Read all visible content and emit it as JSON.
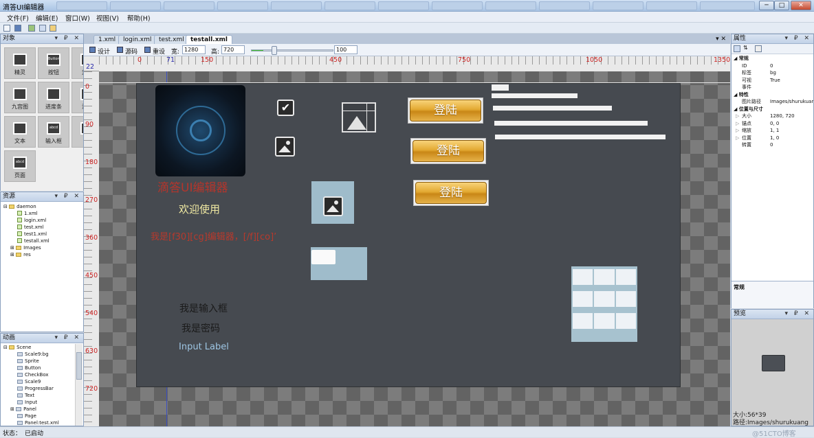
{
  "window": {
    "title": "滴答UI编辑器",
    "min": "─",
    "max": "□",
    "close": "✕"
  },
  "menu": {
    "file": "文件(F)",
    "edit": "编辑(E)",
    "window": "窗口(W)",
    "view": "视图(V)",
    "help": "帮助(H)"
  },
  "objects_panel": {
    "title": "对象",
    "items": [
      {
        "label": "精灵"
      },
      {
        "label": "按钮"
      },
      {
        "label": "复选"
      },
      {
        "label": "九宫图"
      },
      {
        "label": "进度条"
      },
      {
        "label": "滑动"
      },
      {
        "label": "文本"
      },
      {
        "label": "输入框"
      },
      {
        "label": "节"
      },
      {
        "label": "页面"
      }
    ],
    "tile_texts": {
      "button": "Button",
      "input": "abcd"
    }
  },
  "resources_panel": {
    "title": "资源",
    "root": "daemon",
    "files": [
      "1.xml",
      "login.xml",
      "test.xml",
      "test1.xml",
      "testall.xml"
    ],
    "folders": [
      "Images",
      "res"
    ]
  },
  "animation_panel": {
    "title": "动画",
    "root": "Scene",
    "items": [
      "Scale9:bg",
      "Sprite",
      "Button",
      "CheckBox",
      "Scale9",
      "ProgressBar",
      "Text",
      "Input",
      "Panel",
      "Page",
      "Panel:test.xml"
    ]
  },
  "editor": {
    "tabs": [
      "1.xml",
      "login.xml",
      "test.xml",
      "testall.xml"
    ],
    "active_tab": "testall.xml",
    "design_label": "设计",
    "source_label": "源码",
    "reset_label": "重设",
    "width_label": "宽:",
    "width_value": "1280",
    "height_label": "高:",
    "height_value": "720",
    "zoom_value": "100",
    "zoom_level": 0.14,
    "ruler_h": [
      "0",
      "71",
      "150",
      "450",
      "750",
      "1050",
      "1350"
    ],
    "ruler_v": [
      "0",
      "90",
      "180",
      "270",
      "360",
      "450",
      "540",
      "630",
      "720"
    ],
    "ruler_corner": "22"
  },
  "stage": {
    "title": "滴答UI编辑器",
    "welcome": "欢迎使用",
    "rich_text": "我是[f30][cg]编辑器，[/f][co]’",
    "input_text": "我是输入框",
    "password_text": "我是密码",
    "input_label": "Input Label",
    "login_label": "登陆",
    "checkbox_checked": true
  },
  "properties": {
    "title": "属性",
    "section_general": "常规",
    "rows_general": [
      {
        "k": "ID",
        "v": "0"
      },
      {
        "k": "标签",
        "v": "bg"
      },
      {
        "k": "可视",
        "v": "True"
      },
      {
        "k": "事件",
        "v": ""
      }
    ],
    "section_feature": "特性",
    "rows_feature": [
      {
        "k": "图片路径",
        "v": "Images/shurukuang"
      }
    ],
    "section_pos": "位置与尺寸",
    "rows_pos": [
      {
        "k": "大小",
        "v": "1280, 720"
      },
      {
        "k": "锚点",
        "v": "0, 0"
      },
      {
        "k": "缩放",
        "v": "1, 1"
      },
      {
        "k": "位置",
        "v": "1, 0"
      },
      {
        "k": "转置",
        "v": "0"
      }
    ],
    "desc_title": "常规"
  },
  "preview": {
    "title": "预览",
    "size": "大小:56*39",
    "path": "路径:Images/shurukuang"
  },
  "status": {
    "label": "状态：",
    "value": "已启动"
  },
  "watermark": "@51CTO博客"
}
